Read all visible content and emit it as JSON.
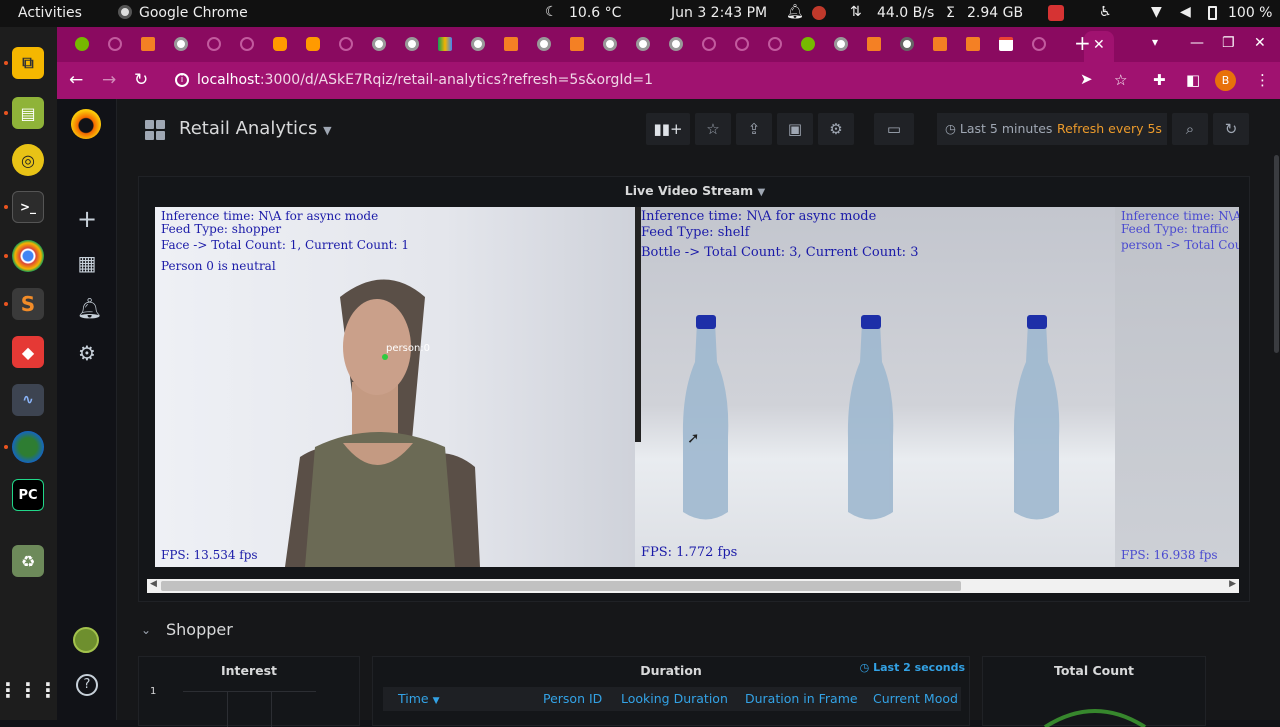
{
  "topbar": {
    "activities": "Activities",
    "app_name": "Google Chrome",
    "weather": "10.6 °C",
    "datetime": "Jun 3  2:43 PM",
    "net_speed": "44.0 B/s",
    "sigma": "Σ",
    "memory": "2.94 GB",
    "battery": "100 %"
  },
  "chrome": {
    "url_host": "localhost",
    "url_path": ":3000/d/ASkE7Rqiz/retail-analytics?refresh=5s&orgId=1",
    "profile_initial": "B",
    "active_tab_close": "✕",
    "new_tab": "+"
  },
  "grafana": {
    "dashboard_title": "Retail Analytics",
    "time_range": "Last 5 minutes",
    "refresh": "Refresh every 5s",
    "video_panel": {
      "title": "Live Video Stream",
      "feeds": [
        {
          "inference": "Inference time: N\\A for async mode",
          "feed_type": "Feed Type: shopper",
          "count": "Face -> Total Count: 1, Current Count: 1",
          "extra": "Person 0 is neutral",
          "tag": "person:0",
          "fps": "FPS: 13.534 fps"
        },
        {
          "inference": "Inference time: N\\A for async mode",
          "feed_type": "Feed Type: shelf",
          "count": "Bottle -> Total Count: 3, Current Count: 3",
          "fps": "FPS: 1.772 fps"
        },
        {
          "inference": "Inference time: N\\A f",
          "feed_type": "Feed Type: traffic",
          "count": "person -> Total Coun",
          "fps": "FPS: 16.938 fps"
        }
      ]
    },
    "shopper_row": {
      "title": "Shopper",
      "interest_title": "Interest",
      "interest_axis_value": "1",
      "duration_title": "Duration",
      "duration_range": "Last 2 seconds",
      "duration_columns": [
        "Time",
        "Person ID",
        "Looking Duration",
        "Duration in Frame",
        "Current Mood"
      ],
      "total_count_title": "Total Count"
    }
  },
  "colors": {
    "chrome_frame": "#8a0a60",
    "chrome_toolbar": "#a01270",
    "grafana_bg": "#161719",
    "grafana_link": "#33a2e5",
    "refresh_orange": "#eb9a2b",
    "gauge_green": "#37872d"
  }
}
